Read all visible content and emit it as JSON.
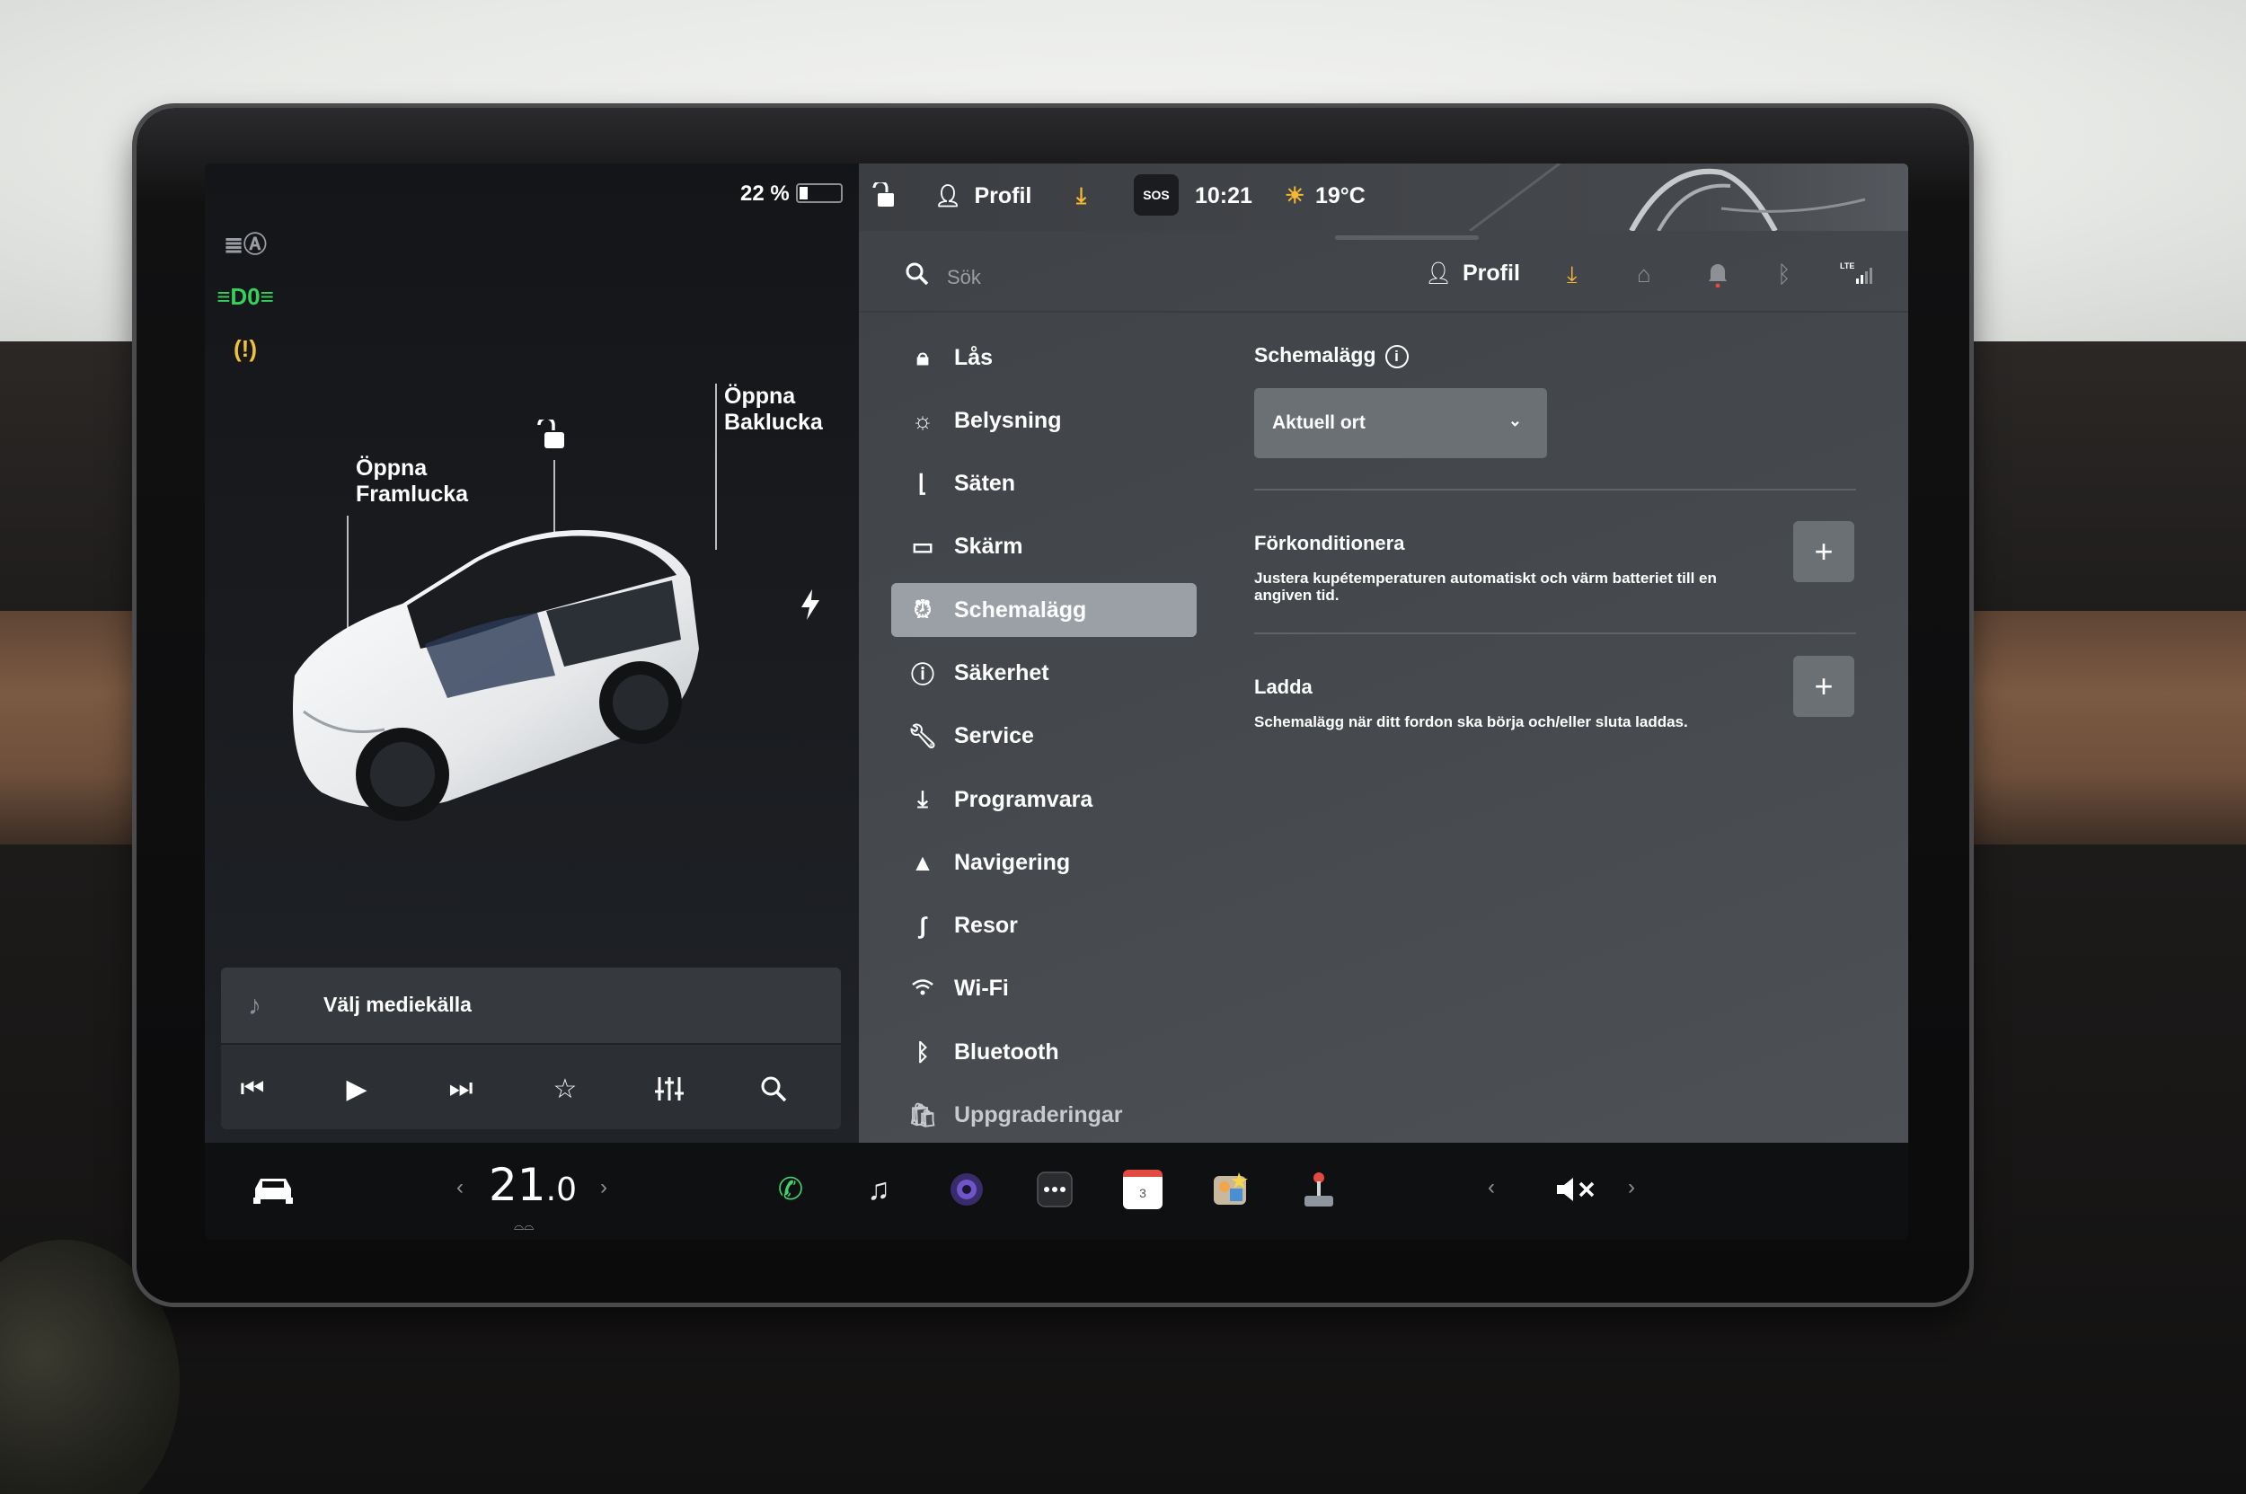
{
  "left_panel": {
    "battery_percent": "22 %",
    "battery_level": 0.22,
    "indicators": [
      {
        "icon": "auto-highbeam-icon",
        "color": "#9a9da3"
      },
      {
        "icon": "parking-lights-icon",
        "color": "#35d15a"
      },
      {
        "icon": "tire-pressure-warning-icon",
        "color": "#f0c23a"
      }
    ],
    "front_trunk_label_1": "Öppna",
    "front_trunk_label_2": "Framlucka",
    "rear_trunk_label_1": "Öppna",
    "rear_trunk_label_2": "Baklucka",
    "media": {
      "source_label": "Välj mediekälla",
      "controls": [
        "previous-track-icon",
        "play-icon",
        "next-track-icon",
        "favorite-star-icon",
        "equalizer-icon",
        "search-icon"
      ]
    }
  },
  "top_status": {
    "profile": "Profil",
    "sos": "SOS",
    "time": "10:21",
    "temperature": "19°C",
    "accent_color": "#f5b731"
  },
  "header": {
    "search_placeholder": "Sök",
    "profile": "Profil"
  },
  "nav": {
    "items": [
      {
        "label": "Lås",
        "icon": "lock-icon"
      },
      {
        "label": "Belysning",
        "icon": "light-icon"
      },
      {
        "label": "Säten",
        "icon": "seat-icon"
      },
      {
        "label": "Skärm",
        "icon": "display-icon"
      },
      {
        "label": "Schemalägg",
        "icon": "alarm-clock-icon",
        "active": true
      },
      {
        "label": "Säkerhet",
        "icon": "safety-icon"
      },
      {
        "label": "Service",
        "icon": "wrench-icon"
      },
      {
        "label": "Programvara",
        "icon": "download-icon"
      },
      {
        "label": "Navigering",
        "icon": "navigation-icon"
      },
      {
        "label": "Resor",
        "icon": "trips-icon"
      },
      {
        "label": "Wi-Fi",
        "icon": "wifi-icon"
      },
      {
        "label": "Bluetooth",
        "icon": "bluetooth-icon"
      },
      {
        "label": "Uppgraderingar",
        "icon": "shopping-bag-icon"
      }
    ]
  },
  "content": {
    "schedule_title": "Schemalägg",
    "location_select": "Aktuell ort",
    "precondition_title": "Förkonditionera",
    "precondition_desc": "Justera kupétemperaturen automatiskt och värm batteriet till en angiven tid.",
    "charge_title": "Ladda",
    "charge_desc": "Schemalägg när ditt fordon ska börja och/eller sluta laddas."
  },
  "taskbar": {
    "temp_whole": "21",
    "temp_decimal": ".0",
    "calendar_day": "3"
  }
}
